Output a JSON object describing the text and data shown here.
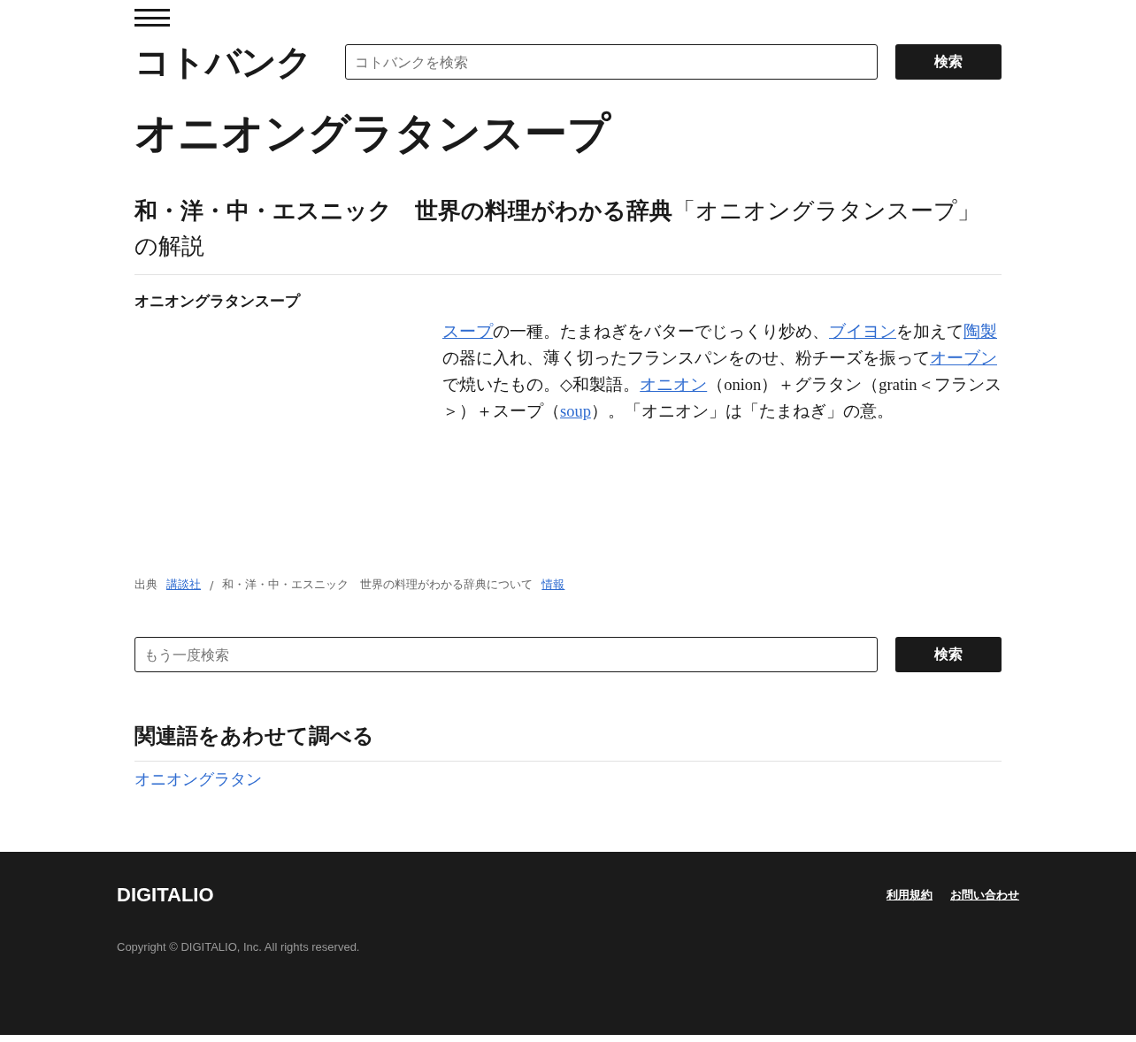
{
  "header": {
    "logo": "コトバンク",
    "search": {
      "placeholder": "コトバンクを検索",
      "button": "検索"
    }
  },
  "page_title": "オニオングラタンスープ",
  "entry": {
    "heading": "**和・洋・中・エスニック　世界の料理がわかる辞典**「オニオングラタンスープ」の解説",
    "term": "オニオングラタンスープ",
    "body": [
      {
        "text": "スープ",
        "link": true
      },
      {
        "text": "の一種。たまねぎをバターでじっくり炒め、",
        "link": false
      },
      {
        "text": "ブイヨン",
        "link": true
      },
      {
        "text": "を加えて",
        "link": false
      },
      {
        "text": "陶製",
        "link": true
      },
      {
        "text": "の器に入れ、薄く切ったフランスパンをのせ、粉チーズを振って",
        "link": false
      },
      {
        "text": "オーブン",
        "link": true
      },
      {
        "text": "で焼いたもの。◇和製語。",
        "link": false
      },
      {
        "text": "オニオン",
        "link": true
      },
      {
        "text": "（onion）＋グラタン（gratin＜フランス＞）＋スープ（",
        "link": false
      },
      {
        "text": "soup",
        "link": true
      },
      {
        "text": "）。「オニオン」は「たまねぎ」の意。",
        "link": false
      }
    ],
    "source": [
      {
        "text": "出典",
        "link": false
      },
      {
        "text": "講談社",
        "link": true
      },
      {
        "text": "/",
        "link": false
      },
      {
        "text": "和・洋・中・エスニック　世界の料理がわかる辞典について",
        "link": false
      },
      {
        "text": "情報",
        "link": true
      }
    ]
  },
  "search_again": {
    "placeholder": "もう一度検索",
    "button": "検索"
  },
  "related": {
    "heading": "関連語をあわせて調べる",
    "items": [
      "オニオングラタン"
    ]
  },
  "footer": {
    "logo": "DIGITALIO",
    "links": [
      "利用規約",
      "お問い合わせ"
    ],
    "copyright": "Copyright © DIGITALIO, Inc. All rights reserved."
  }
}
